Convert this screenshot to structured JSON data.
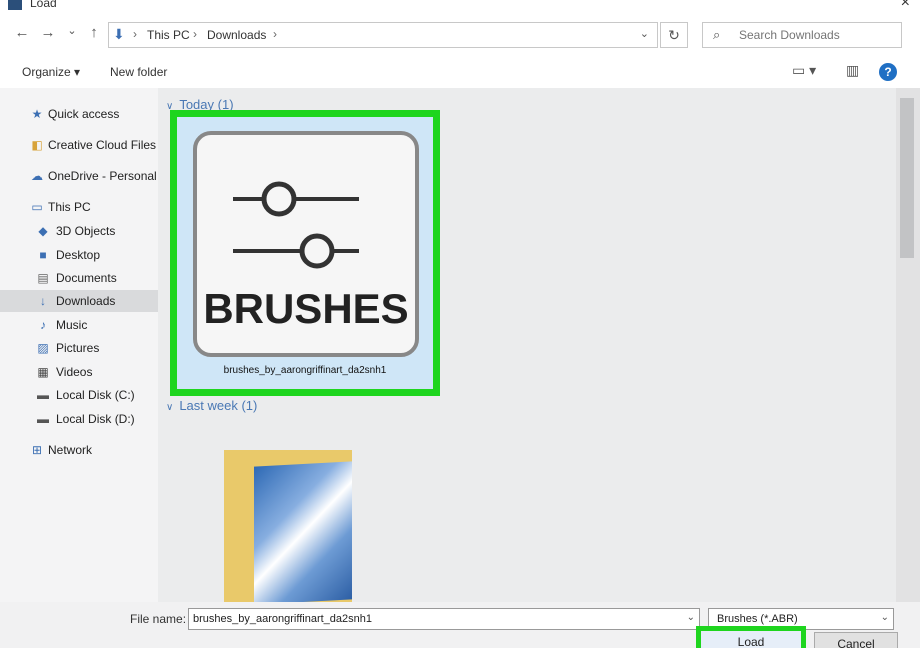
{
  "window": {
    "title": "Load",
    "close_glyph": "×"
  },
  "nav": {
    "back": "←",
    "forward": "→",
    "recent": "⌄",
    "up": "↑"
  },
  "path": {
    "segments": [
      "This PC",
      "Downloads"
    ],
    "separator": "›",
    "dropdown": "⌄"
  },
  "refresh_glyph": "↻",
  "search": {
    "placeholder": "Search Downloads",
    "icon": "search-icon"
  },
  "toolbar": {
    "organize": "Organize ▾",
    "new_folder": "New folder",
    "view_icon": "▭ ▾",
    "pane_icon": "▥",
    "help": "?"
  },
  "sidebar": {
    "items": [
      {
        "label": "Quick access",
        "icon": "★"
      },
      {
        "label": "Creative Cloud Files",
        "icon": "◧"
      },
      {
        "label": "OneDrive - Personal",
        "icon": "☁"
      },
      {
        "label": "This PC",
        "icon": "▭"
      },
      {
        "label": "3D Objects",
        "icon": "◆"
      },
      {
        "label": "Desktop",
        "icon": "■"
      },
      {
        "label": "Documents",
        "icon": "▤"
      },
      {
        "label": "Downloads",
        "icon": "↓",
        "selected": true
      },
      {
        "label": "Music",
        "icon": "♪"
      },
      {
        "label": "Pictures",
        "icon": "▨"
      },
      {
        "label": "Videos",
        "icon": "▦"
      },
      {
        "label": "Local Disk (C:)",
        "icon": "▬"
      },
      {
        "label": "Local Disk (D:)",
        "icon": "▬"
      },
      {
        "label": "Network",
        "icon": "⊞"
      }
    ]
  },
  "groups": {
    "today": {
      "label": "Today (1)",
      "chevron": "∨"
    },
    "last_week": {
      "label": "Last week (1)",
      "chevron": "∨"
    }
  },
  "file": {
    "thumbnail_text": "BRUSHES",
    "name": "brushes_by_aarongriffinart_da2snh1"
  },
  "bottom": {
    "file_name_label": "File name:",
    "file_name_value": "brushes_by_aarongriffinart_da2snh1",
    "file_type": "Brushes (*.ABR)",
    "dropdown": "⌄",
    "load": "Load",
    "cancel": "Cancel"
  },
  "colors": {
    "highlight": "#1ed51e",
    "accent": "#1f6fc4",
    "selection": "#cfe6f7"
  }
}
